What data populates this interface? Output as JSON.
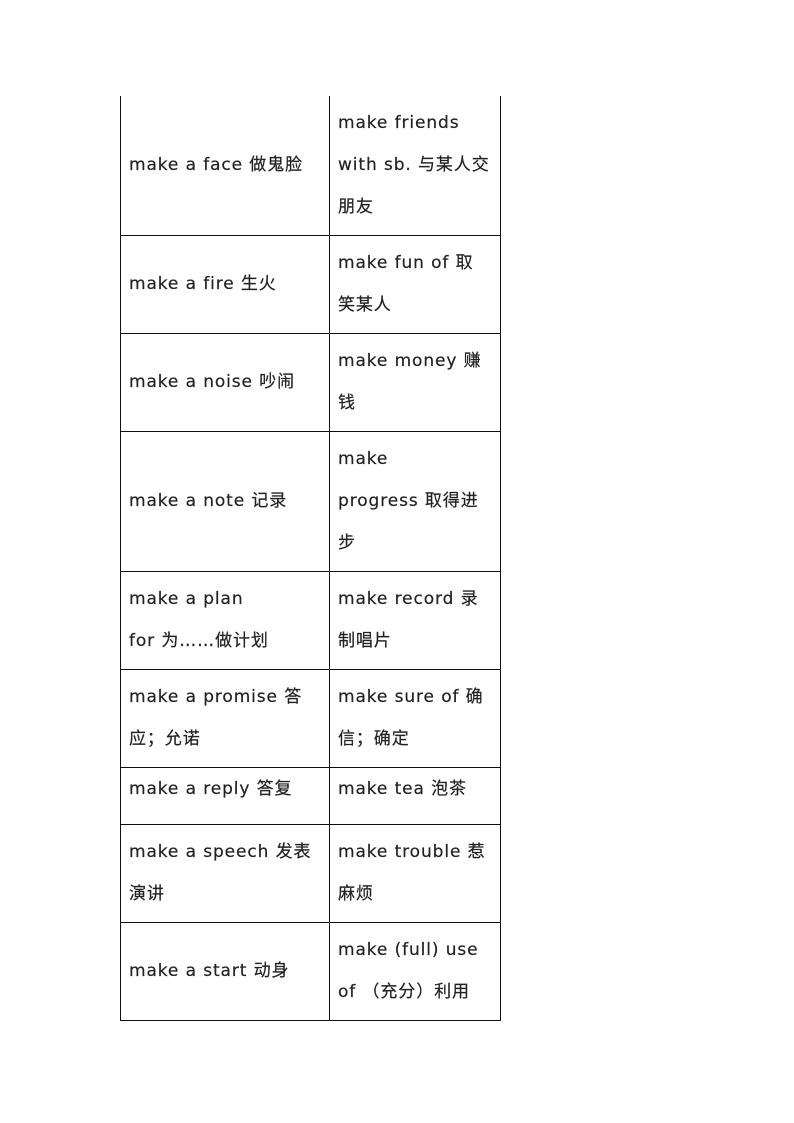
{
  "document": {
    "table": {
      "rows": [
        {
          "left": "make a face 做鬼脸",
          "right": "make friends\nwith sb. 与某人交\n朋友",
          "height": "tall3"
        },
        {
          "left": "make a fire 生火",
          "right": "make fun of  取\n笑某人",
          "height": "two"
        },
        {
          "left": "make a noise 吵闹",
          "right": "make money 赚\n钱",
          "height": "two"
        },
        {
          "left": "make a note  记录",
          "right": "make\nprogress 取得进\n步",
          "height": "tall3"
        },
        {
          "left": "make a plan\nfor  为……做计划",
          "right": "make record 录\n制唱片",
          "height": "two"
        },
        {
          "left": "make a promise 答\n应；允诺",
          "right": "make sure of 确\n信；确定",
          "height": "two"
        },
        {
          "left": "make a reply 答复",
          "right": "make tea 泡茶",
          "height": "one"
        },
        {
          "left": "make a speech 发表\n演讲",
          "right": "make trouble 惹\n麻烦",
          "height": "two"
        },
        {
          "left": "make a start 动身",
          "right": "make (full) use\nof （充分）利用",
          "height": "two"
        }
      ]
    }
  }
}
